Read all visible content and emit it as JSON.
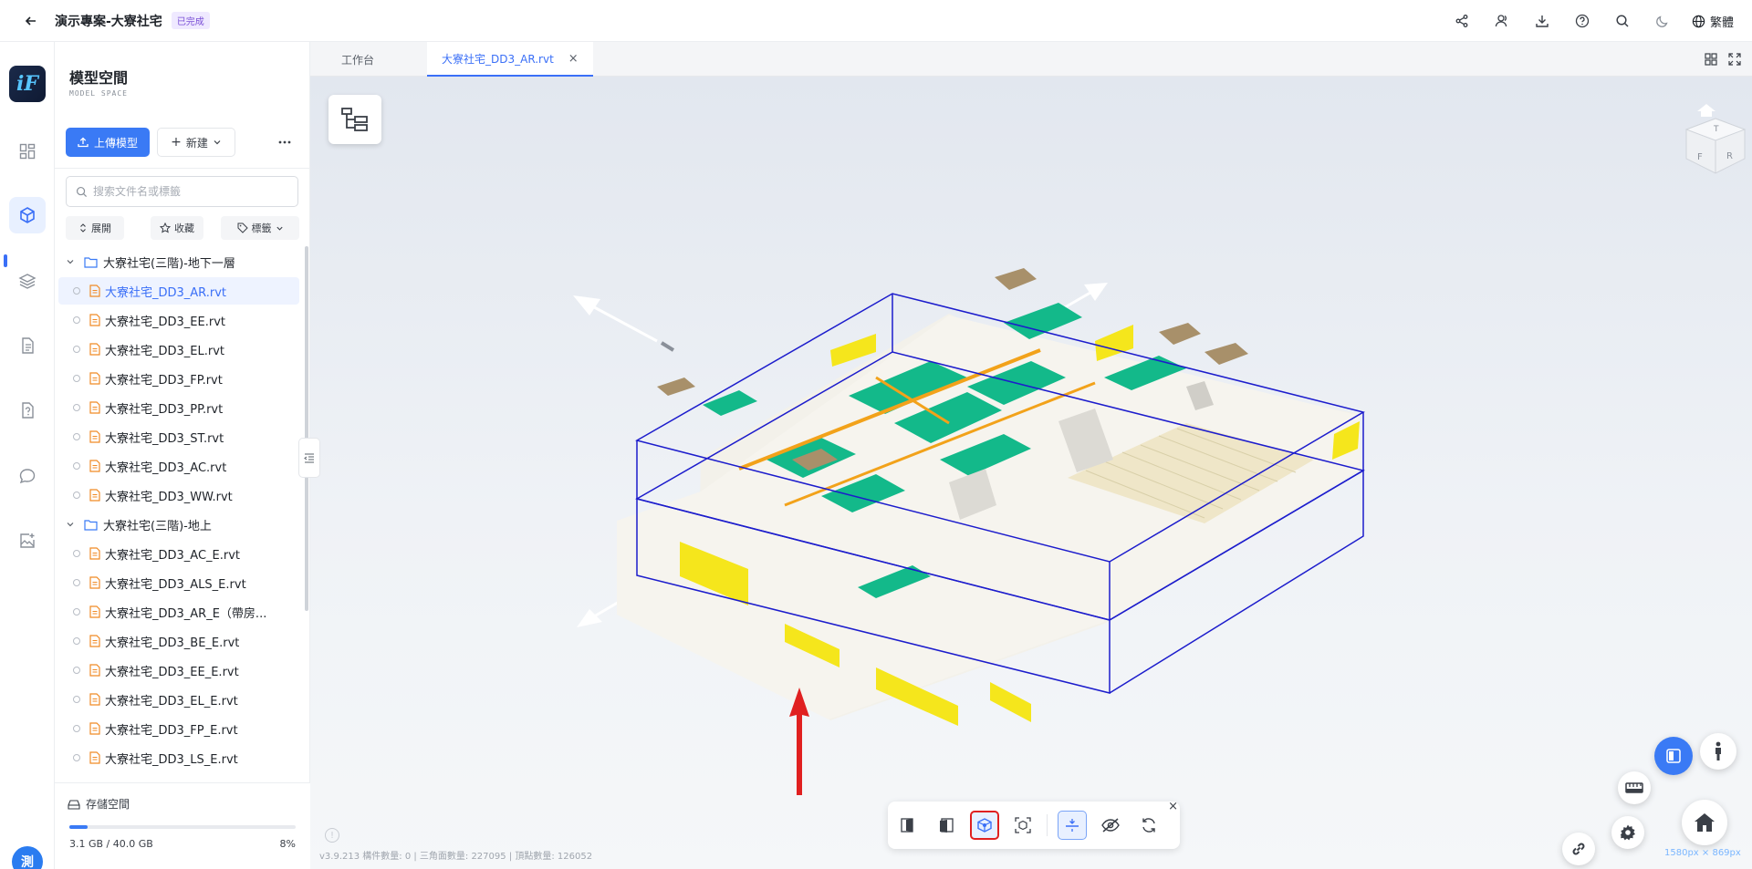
{
  "header": {
    "project_title": "演示專案-大寮社宅",
    "status": "已完成",
    "language": "繁體"
  },
  "panel": {
    "title": "模型空間",
    "subtitle": "MODEL SPACE",
    "upload_label": "上傳模型",
    "new_label": "新建",
    "search_placeholder": "搜索文件名或標籤",
    "filters": {
      "expand": "展開",
      "favorite": "收藏",
      "tags": "標籤"
    },
    "folders": [
      {
        "name": "大寮社宅(三階)-地下一層",
        "files": [
          "大寮社宅_DD3_AR.rvt",
          "大寮社宅_DD3_EE.rvt",
          "大寮社宅_DD3_EL.rvt",
          "大寮社宅_DD3_FP.rvt",
          "大寮社宅_DD3_PP.rvt",
          "大寮社宅_DD3_ST.rvt",
          "大寮社宅_DD3_AC.rvt",
          "大寮社宅_DD3_WW.rvt"
        ]
      },
      {
        "name": "大寮社宅(三階)-地上",
        "files": [
          "大寮社宅_DD3_AC_E.rvt",
          "大寮社宅_DD3_ALS_E.rvt",
          "大寮社宅_DD3_AR_E（帶房...",
          "大寮社宅_DD3_BE_E.rvt",
          "大寮社宅_DD3_EE_E.rvt",
          "大寮社宅_DD3_EL_E.rvt",
          "大寮社宅_DD3_FP_E.rvt",
          "大寮社宅_DD3_LS_E.rvt"
        ]
      }
    ],
    "storage": {
      "label": "存儲空間",
      "used": "3.1 GB / 40.0 GB",
      "percent_label": "8%",
      "percent": 8
    }
  },
  "user": {
    "avatar_text": "測"
  },
  "tabs": [
    {
      "label": "工作台"
    },
    {
      "label": "大寮社宅_DD3_AR.rvt",
      "active": true
    }
  ],
  "viewer": {
    "version_info": "v3.9.213   構件數量: 0 | 三角面數量: 227095 | 頂點數量: 126052",
    "size_info": "1580px × 869px",
    "viewcube": {
      "top": "T",
      "front": "F",
      "right": "R"
    }
  },
  "colors": {
    "accent": "#3a7af5",
    "model_green": "#13b98a",
    "model_yellow": "#f5e61c",
    "bbox_blue": "#1c1ccc",
    "annotation_red": "#e02020"
  }
}
